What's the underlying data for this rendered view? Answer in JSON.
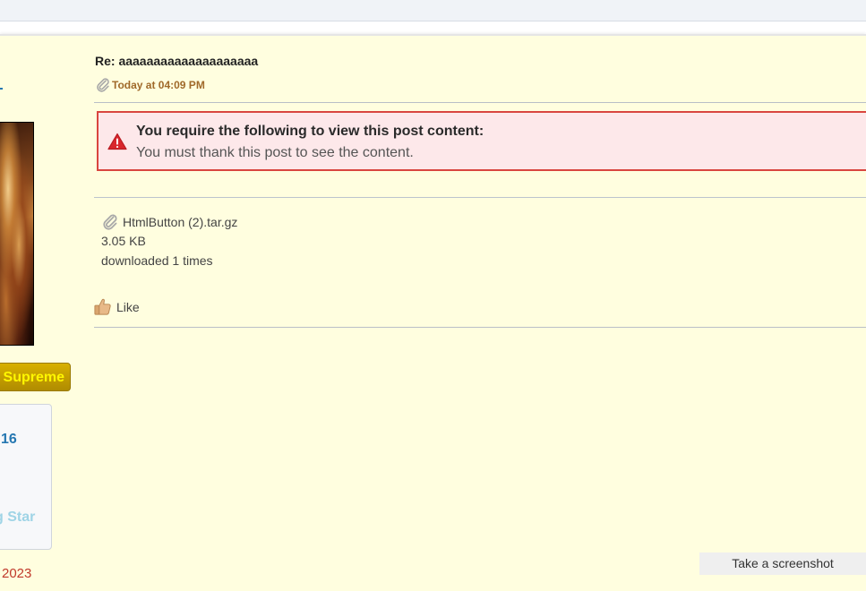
{
  "post": {
    "title": "Re: aaaaaaaaaaaaaaaaaaaa",
    "date": "Today at 04:09 PM"
  },
  "notice": {
    "title": "You require the following to view this post content:",
    "text": "You must thank this post to see the content."
  },
  "attachment": {
    "filename": "HtmlButton (2).tar.gz",
    "size": "3.05 KB",
    "downloads": "downloaded 1 times"
  },
  "actions": {
    "like_label": "Like",
    "screenshot_label": "Take a screenshot"
  },
  "user": {
    "rank": "Supreme",
    "stat_number": "16",
    "stat_star": "g Star",
    "join_year": "2023"
  },
  "icons": {
    "clip": "paperclip-icon",
    "warning": "warning-icon",
    "like": "thumbs-up-icon"
  },
  "colors": {
    "background": "#fffedf",
    "notice_bg": "#fde8ea",
    "notice_border": "#d9463f",
    "date": "#a0692a",
    "rank_text": "#fff700",
    "link_blue": "#2577b1"
  }
}
